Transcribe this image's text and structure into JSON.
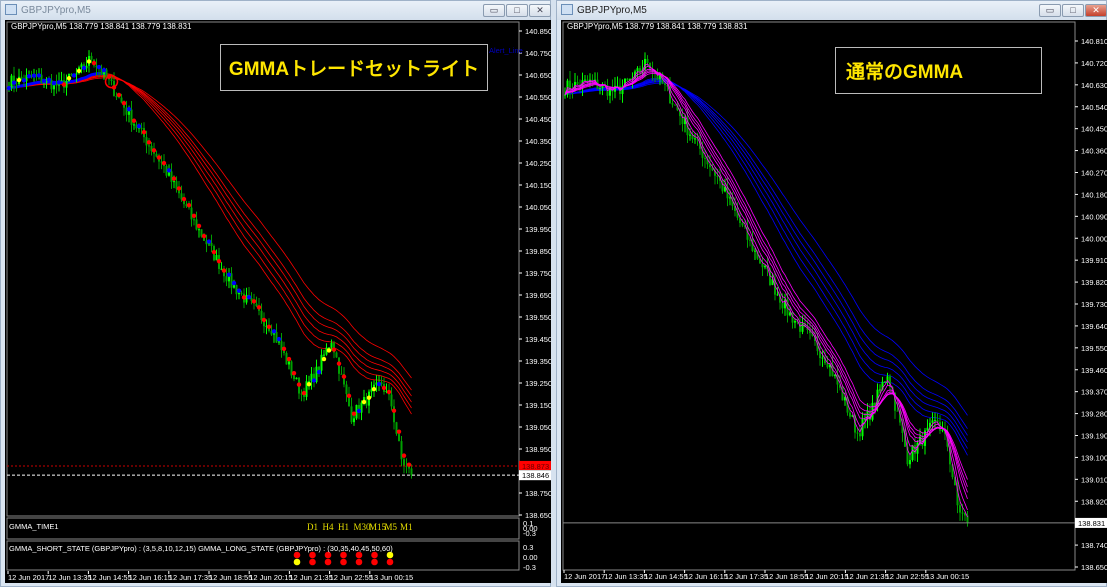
{
  "left_window": {
    "title": "GBPJPYpro,M5",
    "info": "GBPJPYpro,M5  138.779 138.841 138.779 138.831",
    "label": "GMMAトレードセットライト",
    "object_label": "Alert_Line",
    "price_ticks": [
      "140.850",
      "140.750",
      "140.650",
      "140.550",
      "140.450",
      "140.350",
      "140.250",
      "140.150",
      "140.050",
      "139.950",
      "139.850",
      "139.750",
      "139.650",
      "139.550",
      "139.450",
      "139.350",
      "139.250",
      "139.150",
      "139.050",
      "138.950",
      "138.750",
      "138.650"
    ],
    "price_range": [
      138.65,
      140.85
    ],
    "alert_price": "138.873",
    "bid_price": "138.846",
    "current_price": "138.831",
    "time_pane": {
      "title": "GMMA_TIME1",
      "timeframes": [
        "D1",
        "H4",
        "H1",
        "M30",
        "M15",
        "M5",
        "M1"
      ],
      "scale": [
        "0.1",
        "0.00",
        "-0.3"
      ]
    },
    "state_pane": {
      "title": "GMMA_SHORT_STATE (GBPJPYpro) : (3,5,8,10,12,15)  GMMA_LONG_STATE (GBPJPYpro) : (30,35,40,45,50,60)",
      "scale": [
        "0.3",
        "0.00",
        "-0.3"
      ],
      "short_states": [
        "red",
        "red",
        "red",
        "red",
        "red",
        "red",
        "yellow"
      ],
      "long_states": [
        "yellow",
        "red",
        "red",
        "red",
        "red",
        "red",
        "red"
      ]
    }
  },
  "right_window": {
    "title": "GBPJPYpro,M5",
    "info": "GBPJPYpro,M5  138.779 138.841 138.779 138.831",
    "label": "通常のGMMA",
    "price_ticks": [
      "140.810",
      "140.720",
      "140.630",
      "140.540",
      "140.450",
      "140.360",
      "140.270",
      "140.180",
      "140.090",
      "140.000",
      "139.910",
      "139.820",
      "139.730",
      "139.640",
      "139.550",
      "139.460",
      "139.370",
      "139.280",
      "139.190",
      "139.100",
      "139.010",
      "138.920",
      "138.740",
      "138.650"
    ],
    "price_range": [
      138.65,
      140.81
    ],
    "current_price": "138.831"
  },
  "time_ticks": [
    "12 Jun 2017",
    "12 Jun 13:35",
    "12 Jun 14:55",
    "12 Jun 16:15",
    "12 Jun 17:35",
    "12 Jun 18:55",
    "12 Jun 20:15",
    "12 Jun 21:35",
    "12 Jun 22:55",
    "13 Jun 00:15"
  ],
  "window_buttons": {
    "minimize": "▭",
    "maximize": "□",
    "close": "✕"
  },
  "chart_data": {
    "type": "candlestick",
    "symbol": "GBPJPYpro",
    "timeframe": "M5",
    "close_path": [
      [
        0,
        140.62
      ],
      [
        10,
        140.64
      ],
      [
        20,
        140.6
      ],
      [
        28,
        140.66
      ],
      [
        33,
        140.73
      ],
      [
        41,
        140.6
      ],
      [
        49,
        140.45
      ],
      [
        61,
        140.25
      ],
      [
        73,
        140.0
      ],
      [
        89,
        139.7
      ],
      [
        105,
        139.5
      ],
      [
        117,
        139.2
      ],
      [
        123,
        139.3
      ],
      [
        129,
        139.45
      ],
      [
        137,
        139.1
      ],
      [
        149,
        139.25
      ],
      [
        153,
        139.15
      ],
      [
        157,
        138.9
      ],
      [
        161,
        138.83
      ]
    ],
    "short_ema_periods": [
      3,
      5,
      8,
      10,
      12,
      15
    ],
    "long_ema_periods": [
      30,
      35,
      40,
      45,
      50,
      60
    ],
    "colors": {
      "bull": "#00ff00",
      "bear": "#00a000",
      "left_long": "#ff0000",
      "left_long_up": "#0000ff",
      "right_short": "#ff00ff",
      "right_long": "#0000ff",
      "label": "#ffe600"
    }
  }
}
